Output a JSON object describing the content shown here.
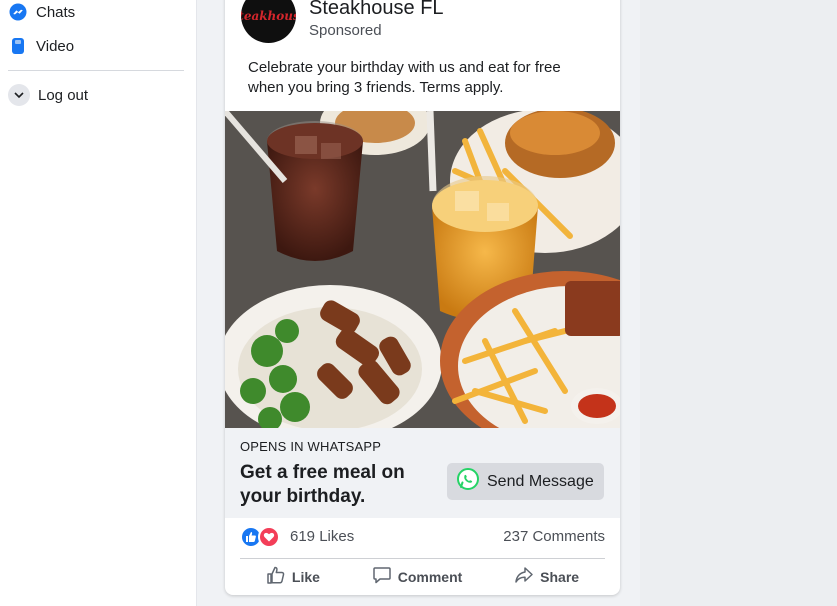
{
  "sidebar": {
    "items": [
      {
        "label": "Chats",
        "icon": "messenger-icon"
      },
      {
        "label": "Video",
        "icon": "video-icon"
      },
      {
        "label": "Log out",
        "icon": "chevron-down-icon"
      }
    ]
  },
  "post": {
    "page_name": "Steakhouse FL",
    "avatar_text": "Steakhouse",
    "sponsored_label": "Sponsored",
    "text": "Celebrate your birthday with us and eat for free when you bring 3 friends. Terms apply.",
    "cta": {
      "caption": "OPENS IN WHATSAPP",
      "headline": "Get a free meal on your birthday.",
      "button_label": "Send Message"
    },
    "stats": {
      "likes": "619 Likes",
      "comments": "237 Comments"
    },
    "actions": {
      "like": "Like",
      "comment": "Comment",
      "share": "Share"
    }
  },
  "colors": {
    "brand_blue": "#1877f2",
    "love_red": "#f33e58",
    "whatsapp_green": "#25d366",
    "avatar_red": "#d4262c"
  }
}
